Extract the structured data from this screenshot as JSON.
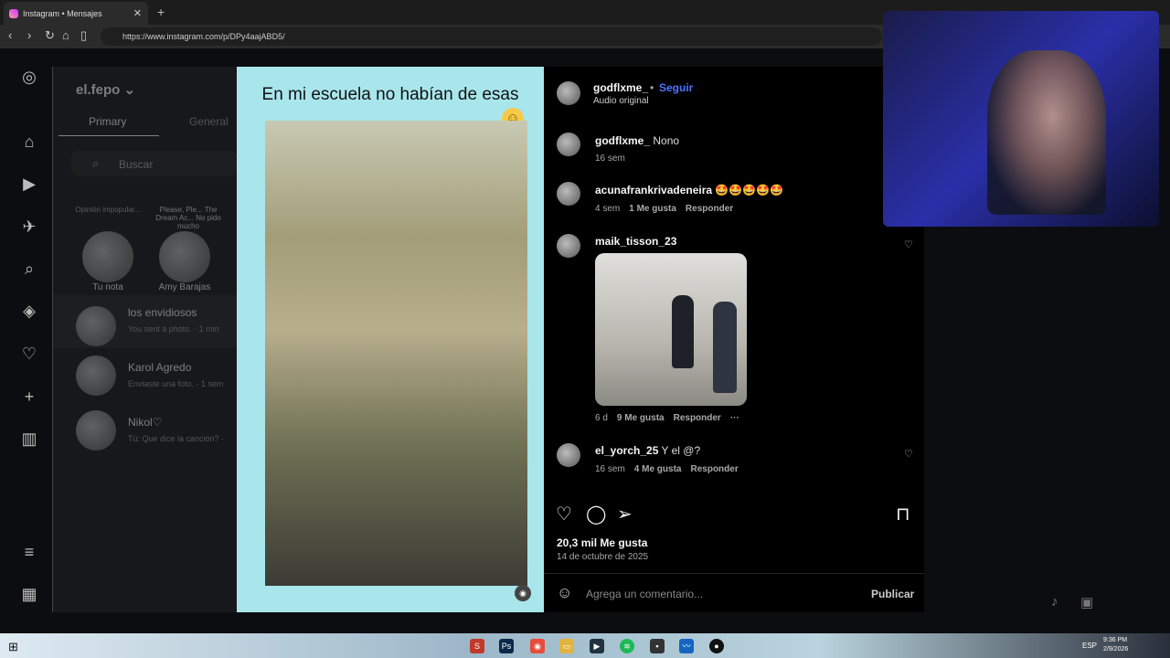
{
  "browser": {
    "tab_title": "Instagram • Mensajes",
    "url": "https://www.instagram.com/p/DPy4aajABD5/"
  },
  "dm": {
    "account": "el.fepo",
    "tabs": [
      "Primary",
      "General"
    ],
    "search_placeholder": "Buscar",
    "notes": [
      {
        "name": "Tu nota",
        "bubble": "Opinión impopular..."
      },
      {
        "name": "Amy Barajas",
        "bubble": "Please, Ple... The Dream Ac... No pido mucho"
      }
    ],
    "conversations": [
      {
        "name": "los envidiosos",
        "preview": "You sent a photo. · 1 min"
      },
      {
        "name": "Karol Agredo",
        "preview": "Enviaste una foto. · 1 sem"
      },
      {
        "name": "Nikol♡",
        "preview": "Tú: Que dice la canción? ·"
      }
    ]
  },
  "post": {
    "caption": "En mi escuela no habían de esas",
    "author": "godflxme_",
    "follow_label": "Seguir",
    "audio": "Audio original",
    "likes": "20,3 mil Me gusta",
    "date": "14 de octubre de 2025",
    "comment_placeholder": "Agrega un comentario...",
    "publish_label": "Publicar",
    "comments": [
      {
        "user": "godflxme_",
        "text": "Nono",
        "time": "16 sem",
        "likes": "",
        "reply": ""
      },
      {
        "user": "acunafrankrivadeneira",
        "text": "🤩🤩🤩🤩🤩",
        "time": "4 sem",
        "likes": "1 Me gusta",
        "reply": "Responder"
      },
      {
        "user": "maik_tisson_23",
        "text": "",
        "time": "6 d",
        "likes": "9 Me gusta",
        "reply": "Responder"
      },
      {
        "user": "el_yorch_25",
        "text": "Y el @?",
        "time": "16 sem",
        "likes": "4 Me gusta",
        "reply": "Responder"
      }
    ]
  },
  "taskbar": {
    "lang": "ESP",
    "time": "9:36 PM",
    "date": "2/9/2026"
  }
}
